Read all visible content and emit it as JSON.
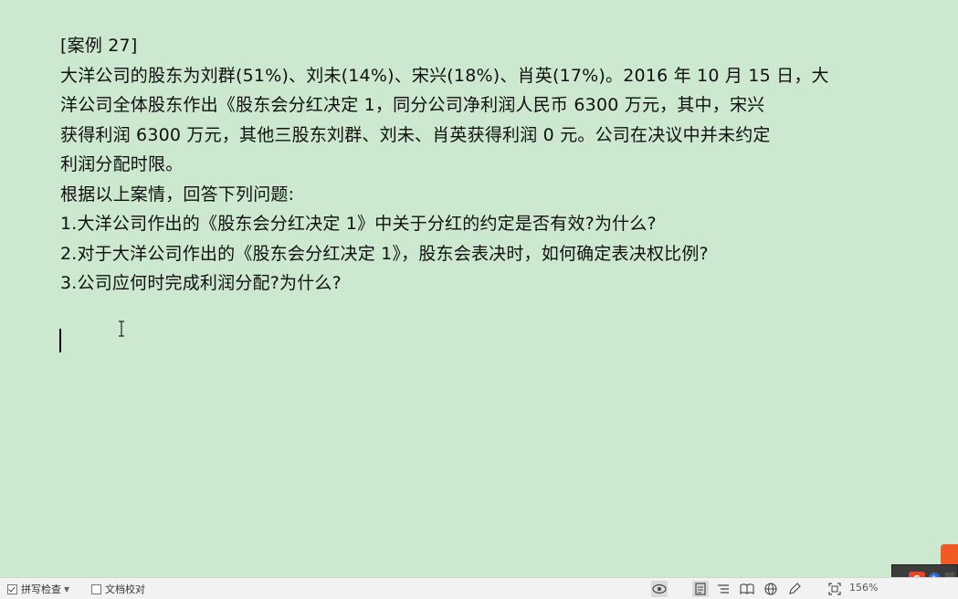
{
  "document": {
    "lines": [
      "[案例  27]",
      "大洋公司的股东为刘群(51%)、刘未(14%)、宋兴(18%)、肖英(17%)。2016  年 10 月 15 日，大",
      "洋公司全体股东作出《股东会分红决定 1，同分公司净利润人民币 6300 万元，其中，宋兴",
      "获得利润 6300 万元，其他三股东刘群、刘未、肖英获得利润 0 元。公司在决议中并未约定",
      "利润分配时限。",
      "根据以上案情，回答下列问题:",
      "1.大洋公司作出的《股东会分红决定 1》中关于分红的约定是否有效?为什么?",
      "2.对于大洋公司作出的《股东会分红决定 1》，股东会表决时，如何确定表决权比例?",
      "3.公司应何时完成利润分配?为什么?"
    ]
  },
  "statusbar": {
    "spellcheck_label": "拼写检查",
    "proofread_label": "文档校对",
    "zoom": "156%"
  },
  "colors": {
    "page_background": "#cce8cf",
    "statusbar_background": "#f2f2f2"
  },
  "icons": {
    "eye": "eye-icon",
    "page_view": "page-view-icon",
    "outline": "outline-icon",
    "reading": "reading-mode-icon",
    "web": "web-layout-icon",
    "pen": "pen-icon",
    "fit": "fit-page-icon"
  }
}
